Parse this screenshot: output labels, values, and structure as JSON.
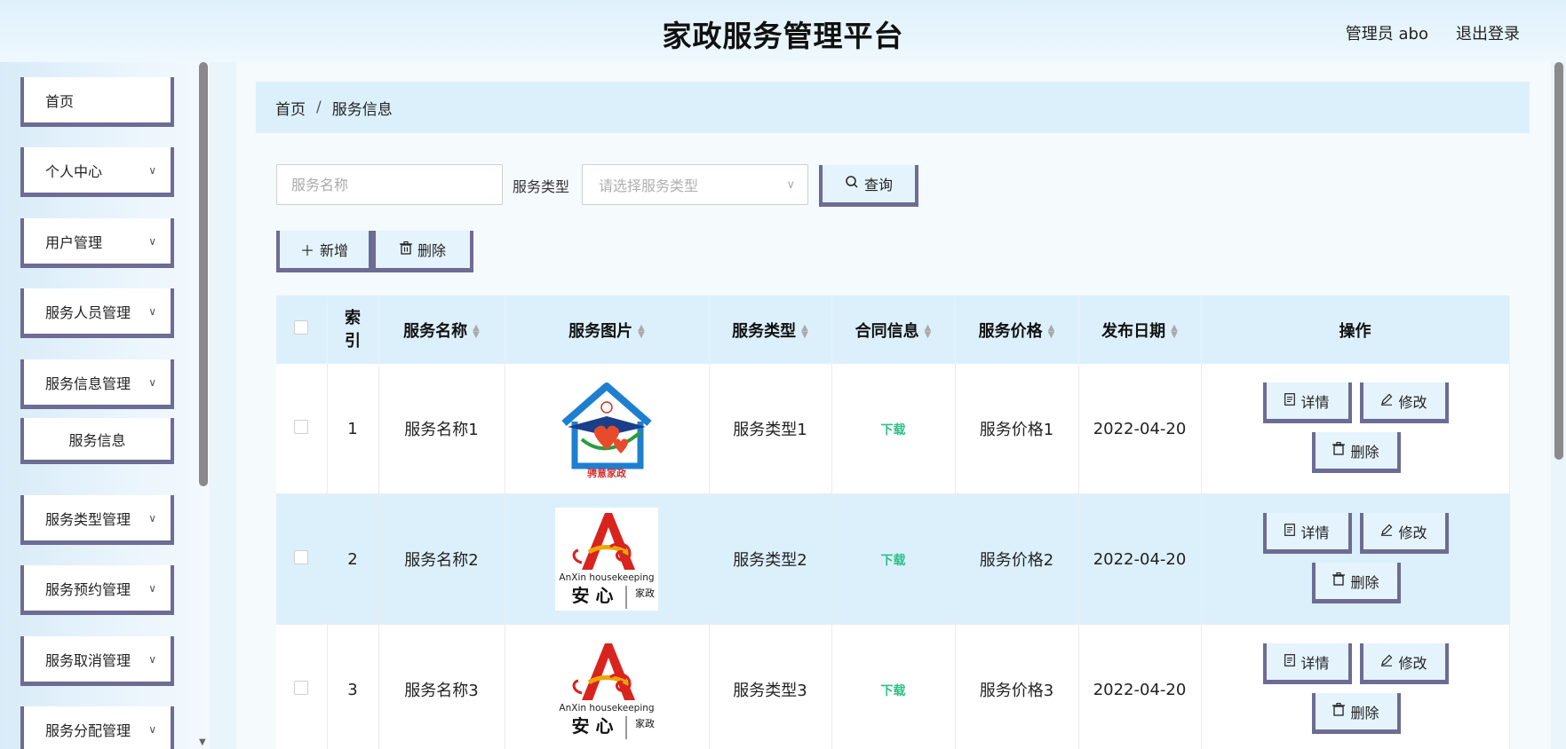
{
  "header": {
    "title": "家政服务管理平台",
    "user": "管理员 abo",
    "logout": "退出登录"
  },
  "sidebar": {
    "items": [
      {
        "label": "首页",
        "has_chevron": false
      },
      {
        "label": "个人中心",
        "has_chevron": true
      },
      {
        "label": "用户管理",
        "has_chevron": true
      },
      {
        "label": "服务人员管理",
        "has_chevron": true
      },
      {
        "label": "服务信息管理",
        "has_chevron": true
      },
      {
        "label": "服务信息",
        "has_chevron": false,
        "submenu": true
      },
      {
        "label": "服务类型管理",
        "has_chevron": true
      },
      {
        "label": "服务预约管理",
        "has_chevron": true
      },
      {
        "label": "服务取消管理",
        "has_chevron": true
      },
      {
        "label": "服务分配管理",
        "has_chevron": true
      }
    ]
  },
  "breadcrumb": {
    "home": "首页",
    "current": "服务信息"
  },
  "search": {
    "name_placeholder": "服务名称",
    "type_label": "服务类型",
    "type_placeholder": "请选择服务类型",
    "query_button": "查询"
  },
  "toolbar": {
    "add_button": "新增",
    "delete_button": "删除"
  },
  "table": {
    "headers": {
      "index": "索引",
      "name": "服务名称",
      "image": "服务图片",
      "type": "服务类型",
      "contract": "合同信息",
      "price": "服务价格",
      "date": "发布日期",
      "ops": "操作"
    },
    "rows": [
      {
        "index": "1",
        "name": "服务名称1",
        "image": "logo-yixi",
        "type": "服务类型1",
        "contract": "下载",
        "price": "服务价格1",
        "date": "2022-04-20"
      },
      {
        "index": "2",
        "name": "服务名称2",
        "image": "logo-anxin",
        "type": "服务类型2",
        "contract": "下载",
        "price": "服务价格2",
        "date": "2022-04-20"
      },
      {
        "index": "3",
        "name": "服务名称3",
        "image": "logo-anxin",
        "type": "服务类型3",
        "contract": "下载",
        "price": "服务价格3",
        "date": "2022-04-20"
      }
    ],
    "ops": {
      "detail": "详情",
      "edit": "修改",
      "delete": "删除"
    }
  },
  "logos": {
    "yixi_text": "骋意家政",
    "anxin_en": "AnXin housekeeping",
    "anxin_cn": "安 心",
    "anxin_side": "家政"
  },
  "colors": {
    "accent": "#6c6c94",
    "header_bg": "#dcf0fc",
    "download": "#2fbf87"
  }
}
